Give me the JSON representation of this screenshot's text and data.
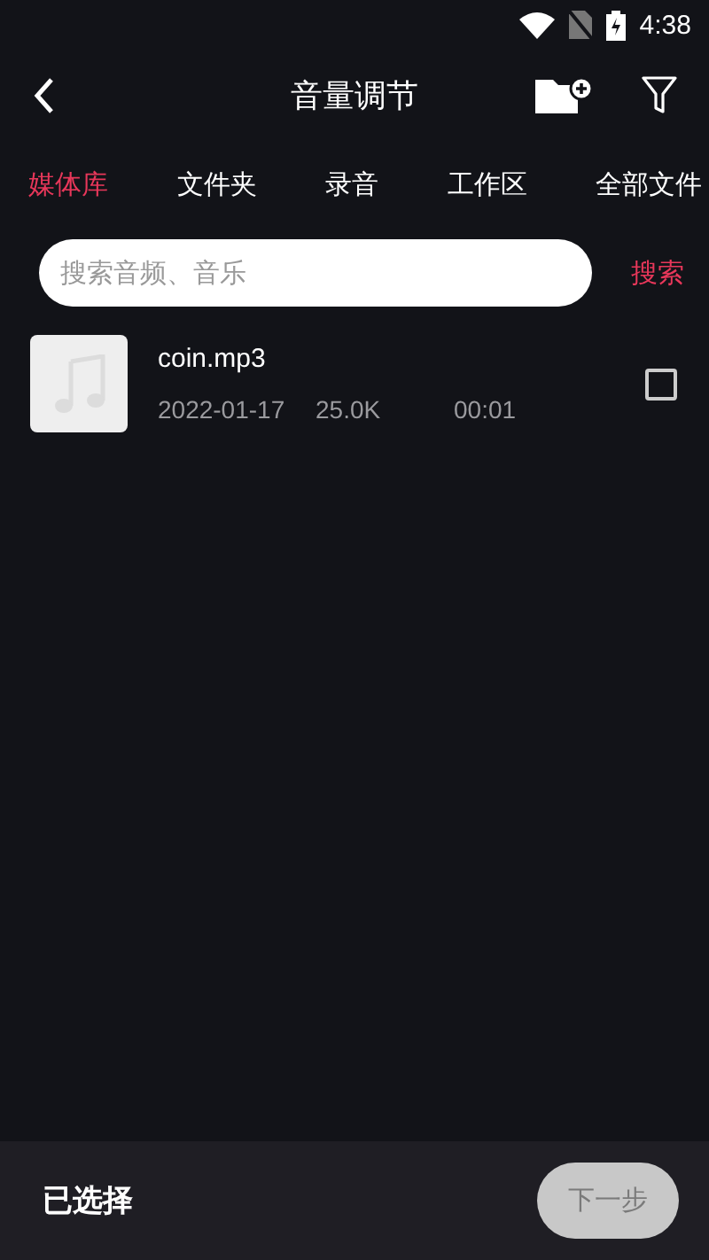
{
  "status_bar": {
    "time": "4:38"
  },
  "header": {
    "title": "音量调节"
  },
  "tabs": [
    {
      "label": "媒体库",
      "selected": true
    },
    {
      "label": "文件夹",
      "selected": false
    },
    {
      "label": "录音",
      "selected": false
    },
    {
      "label": "工作区",
      "selected": false
    },
    {
      "label": "全部文件",
      "selected": false
    }
  ],
  "search": {
    "placeholder": "搜索音频、音乐",
    "button": "搜索"
  },
  "files": [
    {
      "name": "coin.mp3",
      "date": "2022-01-17",
      "size": "25.0K",
      "duration": "00:01",
      "checked": false
    }
  ],
  "footer": {
    "label": "已选择",
    "next_button": {
      "label": "下一步",
      "disabled": true
    }
  }
}
